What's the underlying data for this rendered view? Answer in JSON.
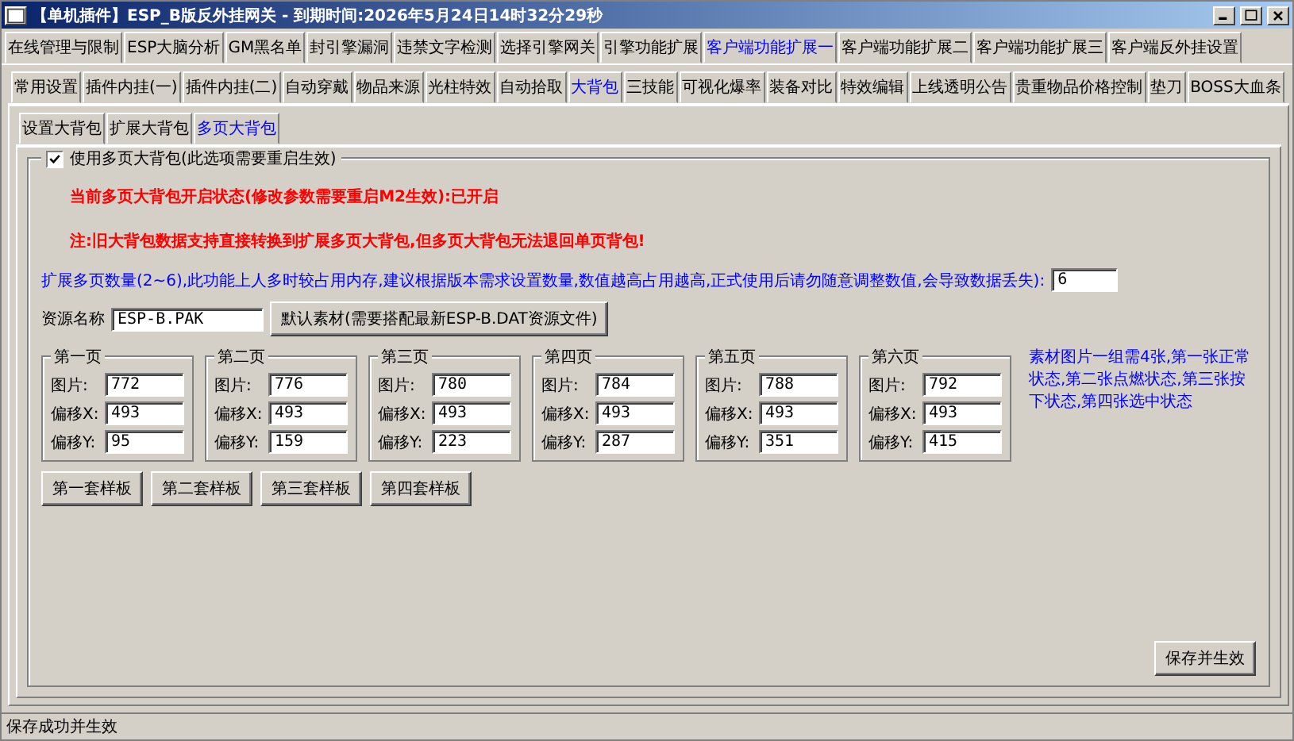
{
  "window": {
    "title": "【单机插件】ESP_B版反外挂网关 - 到期时间:2026年5月24日14时32分29秒"
  },
  "main_tabs": [
    {
      "label": "在线管理与限制",
      "selected": false
    },
    {
      "label": "ESP大脑分析",
      "selected": false
    },
    {
      "label": "GM黑名单",
      "selected": false
    },
    {
      "label": "封引擎漏洞",
      "selected": false
    },
    {
      "label": "违禁文字检测",
      "selected": false
    },
    {
      "label": "选择引擎网关",
      "selected": false
    },
    {
      "label": "引擎功能扩展",
      "selected": false
    },
    {
      "label": "客户端功能扩展一",
      "selected": true
    },
    {
      "label": "客户端功能扩展二",
      "selected": false
    },
    {
      "label": "客户端功能扩展三",
      "selected": false
    },
    {
      "label": "客户端反外挂设置",
      "selected": false
    }
  ],
  "sub_tabs": [
    {
      "label": "常用设置",
      "selected": false
    },
    {
      "label": "插件内挂(一)",
      "selected": false
    },
    {
      "label": "插件内挂(二)",
      "selected": false
    },
    {
      "label": "自动穿戴",
      "selected": false
    },
    {
      "label": "物品来源",
      "selected": false
    },
    {
      "label": "光柱特效",
      "selected": false
    },
    {
      "label": "自动拾取",
      "selected": false
    },
    {
      "label": "大背包",
      "selected": true
    },
    {
      "label": "三技能",
      "selected": false
    },
    {
      "label": "可视化爆率",
      "selected": false
    },
    {
      "label": "装备对比",
      "selected": false
    },
    {
      "label": "特效编辑",
      "selected": false
    },
    {
      "label": "上线透明公告",
      "selected": false
    },
    {
      "label": "贵重物品价格控制",
      "selected": false
    },
    {
      "label": "垫刀",
      "selected": false
    },
    {
      "label": "BOSS大血条",
      "selected": false
    }
  ],
  "page_tabs": [
    {
      "label": "设置大背包",
      "selected": false
    },
    {
      "label": "扩展大背包",
      "selected": false
    },
    {
      "label": "多页大背包",
      "selected": true
    }
  ],
  "option": {
    "label": "使用多页大背包(此选项需要重启生效)",
    "checked": true
  },
  "status_line": "当前多页大背包开启状态(修改参数需要重启M2生效):已开启",
  "warning": "注:旧大背包数据支持直接转换到扩展多页大背包,但多页大背包无法退回单页背包!",
  "page_count": {
    "label": "扩展多页数量(2~6),此功能上人多时较占用内存,建议根据版本需求设置数量,数值越高占用越高,正式使用后请勿随意调整数值,会导致数据丢失):",
    "value": "6"
  },
  "resource": {
    "label": "资源名称",
    "value": "ESP-B.PAK"
  },
  "default_button": "默认素材(需要搭配最新ESP-B.DAT资源文件)",
  "pages": [
    {
      "title": "第一页",
      "fields": [
        {
          "label": "图片:",
          "value": "772"
        },
        {
          "label": "偏移X:",
          "value": "493"
        },
        {
          "label": "偏移Y:",
          "value": "95"
        }
      ]
    },
    {
      "title": "第二页",
      "fields": [
        {
          "label": "图片:",
          "value": "776"
        },
        {
          "label": "偏移X:",
          "value": "493"
        },
        {
          "label": "偏移Y:",
          "value": "159"
        }
      ]
    },
    {
      "title": "第三页",
      "fields": [
        {
          "label": "图片:",
          "value": "780"
        },
        {
          "label": "偏移X:",
          "value": "493"
        },
        {
          "label": "偏移Y:",
          "value": "223"
        }
      ]
    },
    {
      "title": "第四页",
      "fields": [
        {
          "label": "图片:",
          "value": "784"
        },
        {
          "label": "偏移X:",
          "value": "493"
        },
        {
          "label": "偏移Y:",
          "value": "287"
        }
      ]
    },
    {
      "title": "第五页",
      "fields": [
        {
          "label": "图片:",
          "value": "788"
        },
        {
          "label": "偏移X:",
          "value": "493"
        },
        {
          "label": "偏移Y:",
          "value": "351"
        }
      ]
    },
    {
      "title": "第六页",
      "fields": [
        {
          "label": "图片:",
          "value": "792"
        },
        {
          "label": "偏移X:",
          "value": "493"
        },
        {
          "label": "偏移Y:",
          "value": "415"
        }
      ]
    }
  ],
  "note": "素材图片一组需4张,第一张正常状态,第二张点燃状态,第三张按下状态,第四张选中状态",
  "template_buttons": [
    "第一套样板",
    "第二套样板",
    "第三套样板",
    "第四套样板"
  ],
  "save_button": "保存并生效",
  "status_bar": "保存成功并生效"
}
